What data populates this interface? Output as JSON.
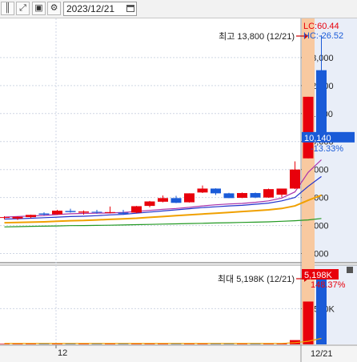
{
  "toolbar": {
    "date_value": "2023/12/21",
    "buttons": [
      "chart-type-icon",
      "zoom-icon",
      "save-icon",
      "settings-icon"
    ]
  },
  "chart_data": [
    {
      "type": "candlestick",
      "panel": "price",
      "y_ticks": [
        "13,000",
        "12,000",
        "11,000",
        "10,000",
        "9,000",
        "8,000",
        "7,000",
        "6,000"
      ],
      "ylim": [
        5700,
        14400
      ],
      "x_label": "12",
      "x_right_label": "12/21",
      "header_lc": "LC:60.44",
      "header_hc": "HC:-26.52",
      "max_annotation": "최고 13,800 (12/21)",
      "current_price": "10,140",
      "current_change": "-13.33%",
      "candles": [
        {
          "o": 7280,
          "h": 7330,
          "l": 7220,
          "c": 7300
        },
        {
          "o": 7250,
          "h": 7320,
          "l": 7200,
          "c": 7310
        },
        {
          "o": 7300,
          "h": 7390,
          "l": 7260,
          "c": 7380
        },
        {
          "o": 7430,
          "h": 7470,
          "l": 7360,
          "c": 7390
        },
        {
          "o": 7400,
          "h": 7560,
          "l": 7380,
          "c": 7530
        },
        {
          "o": 7520,
          "h": 7600,
          "l": 7460,
          "c": 7480
        },
        {
          "o": 7460,
          "h": 7540,
          "l": 7390,
          "c": 7500
        },
        {
          "o": 7490,
          "h": 7560,
          "l": 7420,
          "c": 7460
        },
        {
          "o": 7450,
          "h": 7680,
          "l": 7430,
          "c": 7480
        },
        {
          "o": 7460,
          "h": 7560,
          "l": 7380,
          "c": 7420
        },
        {
          "o": 7460,
          "h": 7700,
          "l": 7440,
          "c": 7690
        },
        {
          "o": 7700,
          "h": 7880,
          "l": 7650,
          "c": 7860
        },
        {
          "o": 7850,
          "h": 8070,
          "l": 7830,
          "c": 7980
        },
        {
          "o": 7980,
          "h": 8060,
          "l": 7800,
          "c": 7810
        },
        {
          "o": 7830,
          "h": 8150,
          "l": 7820,
          "c": 8150
        },
        {
          "o": 8180,
          "h": 8430,
          "l": 8160,
          "c": 8320
        },
        {
          "o": 8320,
          "h": 8330,
          "l": 8090,
          "c": 8150
        },
        {
          "o": 8150,
          "h": 8170,
          "l": 7980,
          "c": 7980
        },
        {
          "o": 7990,
          "h": 8180,
          "l": 7980,
          "c": 8160
        },
        {
          "o": 8160,
          "h": 8180,
          "l": 7980,
          "c": 8000
        },
        {
          "o": 8000,
          "h": 8320,
          "l": 7990,
          "c": 8300
        },
        {
          "o": 8100,
          "h": 8320,
          "l": 8010,
          "c": 8320
        },
        {
          "o": 8320,
          "h": 9290,
          "l": 8300,
          "c": 9000
        },
        {
          "o": 9400,
          "h": 11600,
          "l": 9400,
          "c": 11600
        },
        {
          "o": 12550,
          "h": 13800,
          "l": 10100,
          "c": 10140
        }
      ],
      "ma_blue": [
        7230,
        7240,
        7260,
        7280,
        7300,
        7320,
        7330,
        7350,
        7380,
        7400,
        7440,
        7480,
        7520,
        7560,
        7600,
        7640,
        7670,
        7700,
        7720,
        7760,
        7800,
        7880,
        8000,
        8400,
        8750
      ],
      "ma_purple": [
        7300,
        7320,
        7340,
        7360,
        7390,
        7420,
        7430,
        7440,
        7450,
        7470,
        7500,
        7540,
        7580,
        7610,
        7650,
        7700,
        7740,
        7770,
        7790,
        7830,
        7880,
        7980,
        8200,
        8900,
        9350
      ],
      "ma_orange": [
        7100,
        7110,
        7120,
        7130,
        7150,
        7170,
        7180,
        7200,
        7220,
        7240,
        7260,
        7290,
        7320,
        7350,
        7380,
        7410,
        7440,
        7470,
        7500,
        7530,
        7560,
        7610,
        7700,
        7900,
        8080
      ],
      "ma_green": [
        6950,
        6960,
        6970,
        6975,
        6985,
        6995,
        7000,
        7005,
        7010,
        7020,
        7030,
        7040,
        7050,
        7060,
        7070,
        7080,
        7090,
        7100,
        7110,
        7120,
        7130,
        7150,
        7170,
        7200,
        7250
      ]
    },
    {
      "type": "bar",
      "panel": "volume",
      "y_ticks": [
        "2,500K"
      ],
      "ylim": [
        0,
        5550
      ],
      "max_annotation": "최대 5,198K (12/21)",
      "current_volume": "5,198K",
      "current_change": "148.37%",
      "values": [
        40,
        30,
        35,
        30,
        40,
        35,
        30,
        30,
        40,
        30,
        45,
        50,
        60,
        40,
        55,
        70,
        40,
        30,
        35,
        30,
        40,
        50,
        300,
        3000,
        5198
      ],
      "volume_ma": [
        60,
        60,
        60,
        60,
        60,
        60,
        60,
        60,
        60,
        60,
        60,
        60,
        60,
        60,
        60,
        60,
        60,
        60,
        60,
        60,
        60,
        70,
        120,
        220,
        420
      ]
    }
  ],
  "colors": {
    "up": "#e8000b",
    "down": "#1a5bd8",
    "ma_blue": "#2233cc",
    "ma_purple": "#aa33aa",
    "ma_orange": "#f0a000",
    "ma_green": "#229922",
    "highlight": "#f8c9a0",
    "axis_bg": "#e9eef8",
    "annotation": "#d00000"
  }
}
